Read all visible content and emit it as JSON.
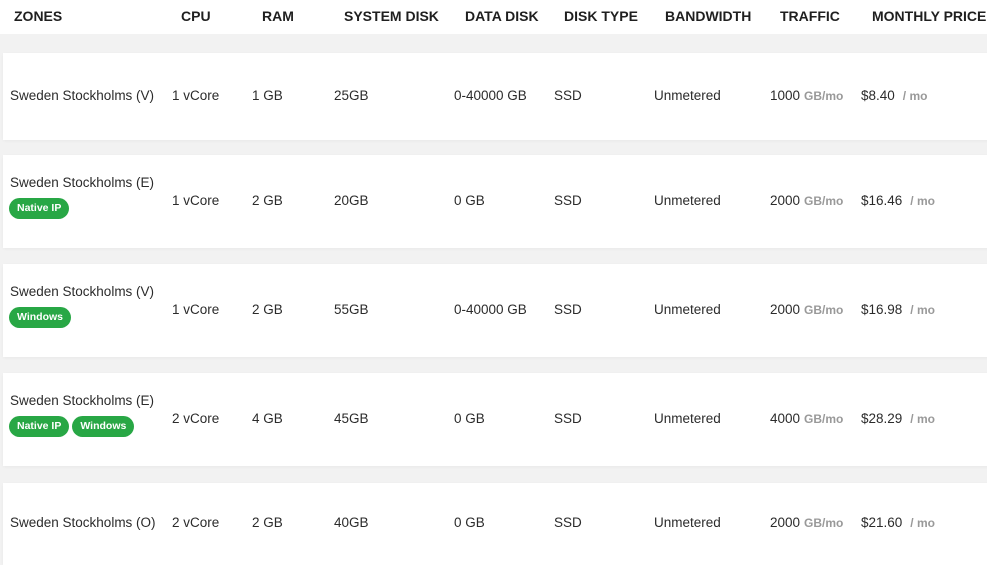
{
  "headers": {
    "zones": "ZONES",
    "cpu": "CPU",
    "ram": "RAM",
    "system_disk": "SYSTEM DISK",
    "data_disk": "DATA DISK",
    "disk_type": "DISK TYPE",
    "bandwidth": "BANDWIDTH",
    "traffic": "TRAFFIC",
    "monthly_price": "MONTHLY PRICE"
  },
  "colors": {
    "badge_green": "#28a745",
    "unit_gray": "#999999"
  },
  "rows": [
    {
      "zone": "Sweden Stockholms (V)",
      "badges": [],
      "cpu": "1 vCore",
      "ram": "1 GB",
      "system_disk": "25GB",
      "data_disk": "0-40000 GB",
      "disk_type": "SSD",
      "bandwidth": "Unmetered",
      "traffic": "1000",
      "traffic_unit": "GB/mo",
      "price": "$8.40",
      "price_unit": "/ mo"
    },
    {
      "zone": "Sweden Stockholms (E)",
      "badges": [
        "Native IP"
      ],
      "cpu": "1 vCore",
      "ram": "2 GB",
      "system_disk": "20GB",
      "data_disk": "0 GB",
      "disk_type": "SSD",
      "bandwidth": "Unmetered",
      "traffic": "2000",
      "traffic_unit": "GB/mo",
      "price": "$16.46",
      "price_unit": "/ mo"
    },
    {
      "zone": "Sweden Stockholms (V)",
      "badges": [
        "Windows"
      ],
      "cpu": "1 vCore",
      "ram": "2 GB",
      "system_disk": "55GB",
      "data_disk": "0-40000 GB",
      "disk_type": "SSD",
      "bandwidth": "Unmetered",
      "traffic": "2000",
      "traffic_unit": "GB/mo",
      "price": "$16.98",
      "price_unit": "/ mo"
    },
    {
      "zone": "Sweden Stockholms (E)",
      "badges": [
        "Native IP",
        "Windows"
      ],
      "cpu": "2 vCore",
      "ram": "4 GB",
      "system_disk": "45GB",
      "data_disk": "0 GB",
      "disk_type": "SSD",
      "bandwidth": "Unmetered",
      "traffic": "4000",
      "traffic_unit": "GB/mo",
      "price": "$28.29",
      "price_unit": "/ mo"
    },
    {
      "zone": "Sweden Stockholms (O)",
      "badges": [],
      "cpu": "2 vCore",
      "ram": "2 GB",
      "system_disk": "40GB",
      "data_disk": "0 GB",
      "disk_type": "SSD",
      "bandwidth": "Unmetered",
      "traffic": "2000",
      "traffic_unit": "GB/mo",
      "price": "$21.60",
      "price_unit": "/ mo"
    }
  ]
}
